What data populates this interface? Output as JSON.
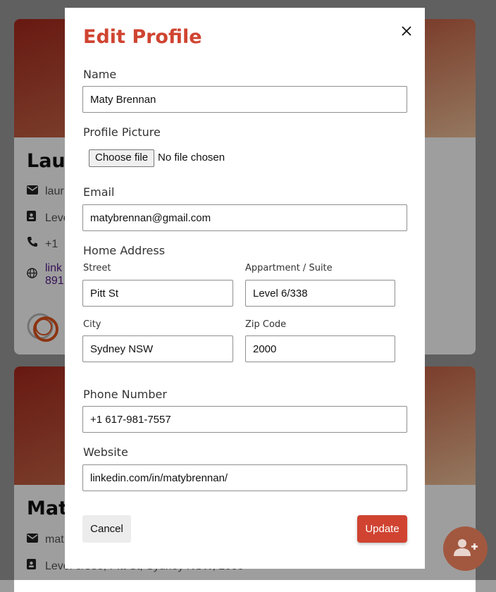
{
  "background_cards": [
    {
      "name_partial": "Lau",
      "email_partial": "laur",
      "address_partial": "Leve",
      "phone_partial": "+1",
      "link_partial_1": "link",
      "link_partial_2": "891"
    },
    {
      "name_partial": "Mat",
      "email_partial": "mat",
      "address_partial": "Level 6/338, Pitt St, Sydney NSW, 2000"
    }
  ],
  "modal": {
    "title": "Edit Profile",
    "name_label": "Name",
    "name_value": "Maty Brennan",
    "picture_label": "Profile Picture",
    "file_button": "Choose file",
    "file_status": "No file chosen",
    "email_label": "Email",
    "email_value": "matybrennan@gmail.com",
    "address_label": "Home Address",
    "street_label": "Street",
    "street_value": "Pitt St",
    "apt_label": "Appartment / Suite",
    "apt_value": "Level 6/338",
    "city_label": "City",
    "city_value": "Sydney NSW",
    "zip_label": "Zip Code",
    "zip_value": "2000",
    "phone_label": "Phone Number",
    "phone_value": "+1 617-981-7557",
    "website_label": "Website",
    "website_value": "linkedin.com/in/matybrennan/",
    "cancel_label": "Cancel",
    "update_label": "Update"
  },
  "colors": {
    "accent": "#cf4431",
    "overlay": "rgba(0,0,0,0.38)"
  },
  "icons": [
    "close-icon",
    "envelope-icon",
    "address-card-icon",
    "phone-icon",
    "globe-icon",
    "user-plus-icon"
  ]
}
